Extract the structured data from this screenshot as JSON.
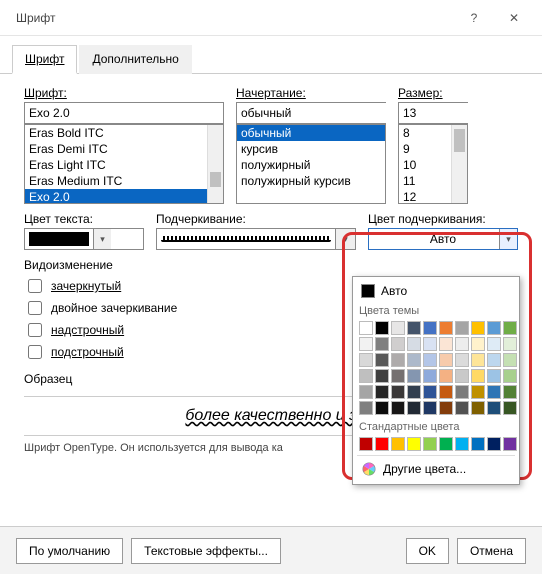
{
  "window": {
    "title": "Шрифт"
  },
  "tabs": {
    "font": "Шрифт",
    "advanced": "Дополнительно"
  },
  "labels": {
    "font": "Шрифт:",
    "style": "Начертание:",
    "size": "Размер:",
    "textColor": "Цвет текста:",
    "underline": "Подчеркивание:",
    "underlineColor": "Цвет подчеркивания:",
    "effects": "Видоизменение",
    "sample": "Образец"
  },
  "font": {
    "value": "Exo 2.0",
    "list": [
      "Eras Bold ITC",
      "Eras Demi ITC",
      "Eras Light ITC",
      "Eras Medium ITC",
      "Exo 2.0"
    ],
    "selected": "Exo 2.0"
  },
  "style": {
    "value": "обычный",
    "list": [
      "обычный",
      "курсив",
      "полужирный",
      "полужирный курсив"
    ],
    "selected": "обычный"
  },
  "size": {
    "value": "13",
    "list": [
      "8",
      "9",
      "10",
      "11",
      "12"
    ]
  },
  "underlineColor": {
    "value": "Авто",
    "auto": "Авто"
  },
  "checks": {
    "strike": "зачеркнутый",
    "dstrike": "двойное зачеркивание",
    "superscript": "надстрочный",
    "subscript": "подстрочный"
  },
  "sampleText": "более качественно и з",
  "note": "Шрифт OpenType. Он используется для вывода ка",
  "dropdown": {
    "themeHeader": "Цвета темы",
    "stdHeader": "Стандартные цвета",
    "more": "Другие цвета...",
    "themeColors": [
      [
        "#ffffff",
        "#000000",
        "#e7e6e6",
        "#44546a",
        "#4472c4",
        "#ed7d31",
        "#a5a5a5",
        "#ffc000",
        "#5b9bd5",
        "#70ad47"
      ],
      [
        "#f2f2f2",
        "#7f7f7f",
        "#d0cece",
        "#d6dce4",
        "#d9e2f3",
        "#fbe5d5",
        "#ededed",
        "#fff2cc",
        "#deebf6",
        "#e2efd9"
      ],
      [
        "#d8d8d8",
        "#595959",
        "#aeabab",
        "#adb9ca",
        "#b4c6e7",
        "#f7cbac",
        "#dbdbdb",
        "#fee599",
        "#bdd7ee",
        "#c5e0b3"
      ],
      [
        "#bfbfbf",
        "#3f3f3f",
        "#757070",
        "#8496b0",
        "#8eaadb",
        "#f4b183",
        "#c9c9c9",
        "#ffd965",
        "#9cc3e5",
        "#a8d08d"
      ],
      [
        "#a5a5a5",
        "#262626",
        "#3a3838",
        "#323f4f",
        "#2f5496",
        "#c55a11",
        "#7b7b7b",
        "#bf9000",
        "#2e75b5",
        "#538135"
      ],
      [
        "#7f7f7f",
        "#0c0c0c",
        "#171616",
        "#222a35",
        "#1f3864",
        "#833c0b",
        "#525252",
        "#7f6000",
        "#1e4e79",
        "#375623"
      ]
    ],
    "stdColors": [
      "#c00000",
      "#ff0000",
      "#ffc000",
      "#ffff00",
      "#92d050",
      "#00b050",
      "#00b0f0",
      "#0070c0",
      "#002060",
      "#7030a0"
    ]
  },
  "buttons": {
    "default": "По умолчанию",
    "textEffects": "Текстовые эффекты...",
    "ok": "OK",
    "cancel": "Отмена"
  }
}
